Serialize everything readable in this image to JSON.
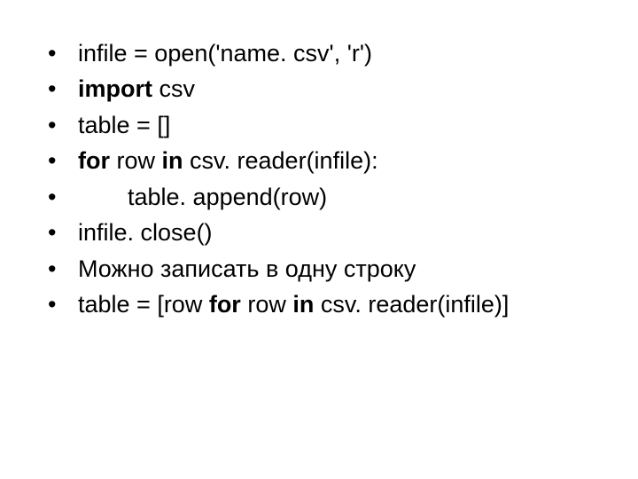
{
  "lines": {
    "l1": {
      "p1": "infile = open('name. csv', 'r')"
    },
    "l2": {
      "p1": " import",
      "p2": " csv"
    },
    "l3": {
      "p1": "table = []"
    },
    "l4": {
      "p1": " for",
      "p2": " row ",
      "p3": "in",
      "p4": " csv. reader(infile):"
    },
    "l5": {
      "p1": "table. append(row)"
    },
    "l6": {
      "p1": " infile. close()"
    },
    "l7": {
      "p1": "Можно записать в одну строку"
    },
    "l8": {
      "p1": " table = [row ",
      "p2": "for",
      "p3": " row ",
      "p4": "in",
      "p5": " csv. reader(infile)]"
    }
  }
}
